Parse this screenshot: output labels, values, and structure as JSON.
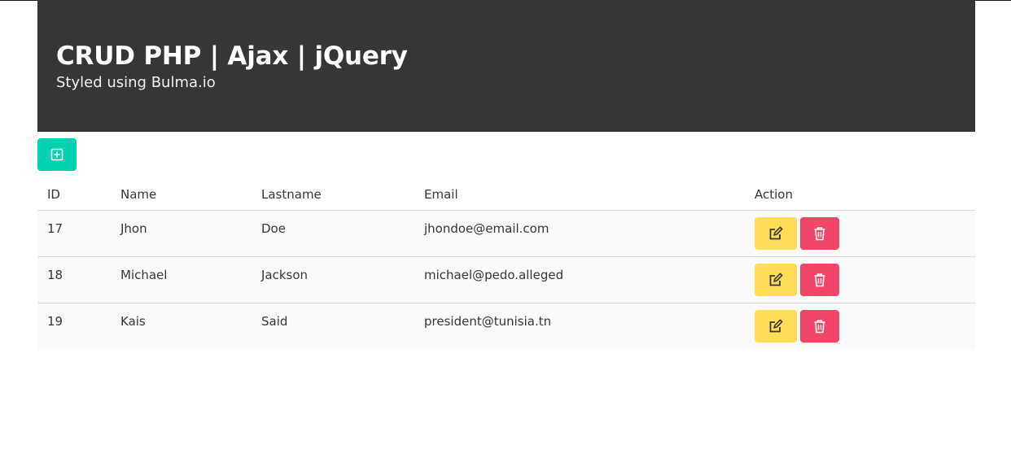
{
  "hero": {
    "title": "CRUD PHP | Ajax | jQuery",
    "subtitle": "Styled using Bulma.io"
  },
  "toolbar": {
    "add_icon": "plus-square-icon",
    "accent": "#00d1b2"
  },
  "table": {
    "headers": [
      "ID",
      "Name",
      "Lastname",
      "Email",
      "Action"
    ],
    "rows": [
      {
        "id": "17",
        "name": "Jhon",
        "lastname": "Doe",
        "email": "jhondoe@email.com"
      },
      {
        "id": "18",
        "name": "Michael",
        "lastname": "Jackson",
        "email": "michael@pedo.alleged"
      },
      {
        "id": "19",
        "name": "Kais",
        "lastname": "Said",
        "email": "president@tunisia.tn"
      }
    ],
    "edit_icon": "edit-icon",
    "delete_icon": "trash-icon",
    "edit_color": "#ffdd57",
    "delete_color": "#f14668"
  }
}
